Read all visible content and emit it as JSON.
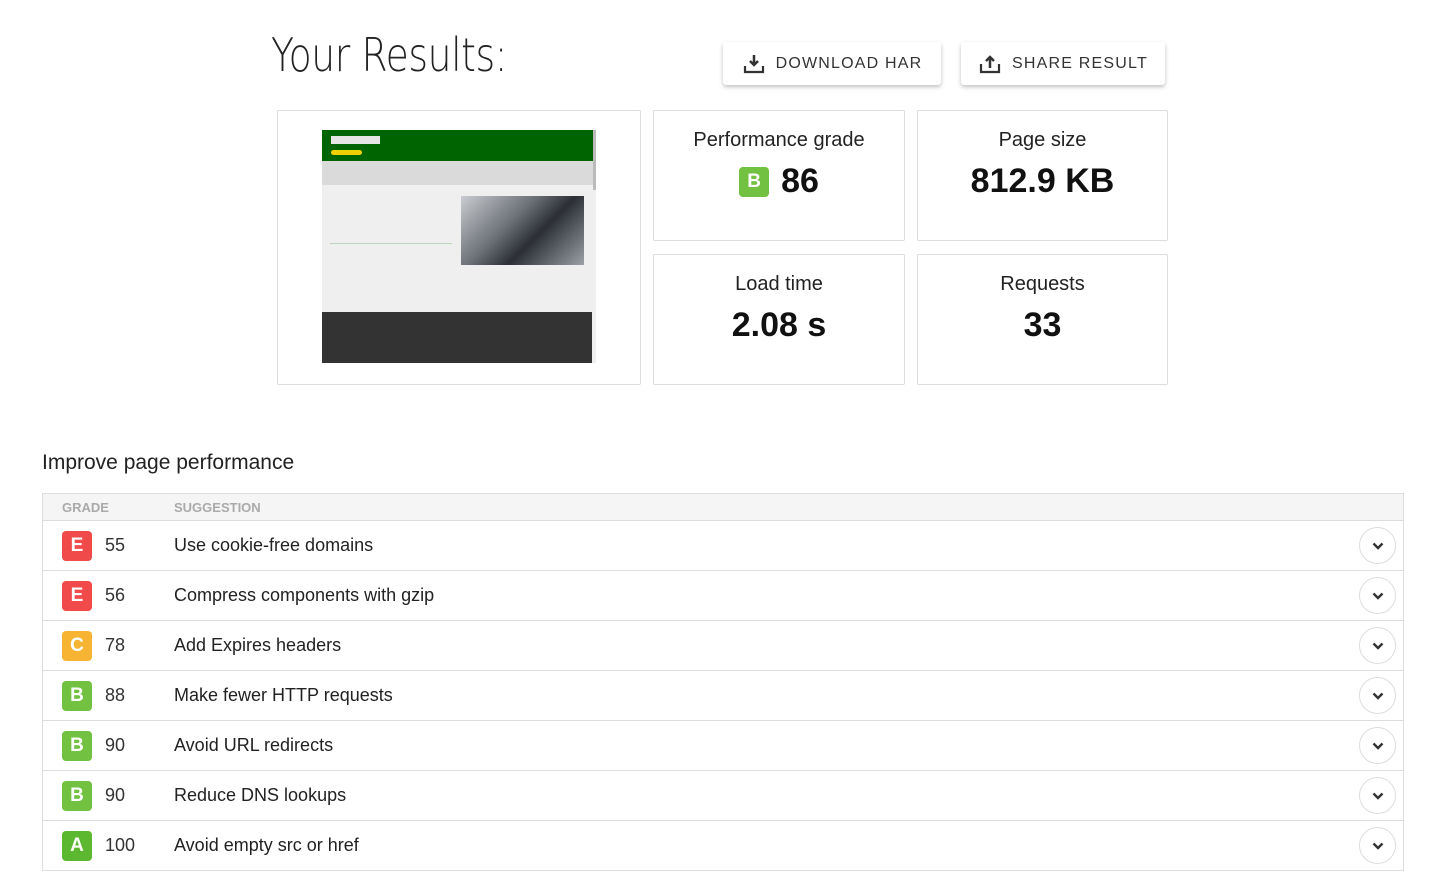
{
  "header": {
    "title": "Your Results:",
    "download_label": "DOWNLOAD HAR",
    "share_label": "SHARE RESULT"
  },
  "metrics": {
    "performance": {
      "label": "Performance grade",
      "grade": "B",
      "value": "86",
      "color": "#72c140"
    },
    "page_size": {
      "label": "Page size",
      "value": "812.9 KB"
    },
    "load_time": {
      "label": "Load time",
      "value": "2.08 s"
    },
    "requests": {
      "label": "Requests",
      "value": "33"
    }
  },
  "improve": {
    "title": "Improve page performance",
    "col_grade": "GRADE",
    "col_suggestion": "SUGGESTION",
    "rows": [
      {
        "grade": "E",
        "score": "55",
        "suggestion": "Use cookie-free domains",
        "color": "#f04a4a"
      },
      {
        "grade": "E",
        "score": "56",
        "suggestion": "Compress components with gzip",
        "color": "#f04a4a"
      },
      {
        "grade": "C",
        "score": "78",
        "suggestion": "Add Expires headers",
        "color": "#f7b432"
      },
      {
        "grade": "B",
        "score": "88",
        "suggestion": "Make fewer HTTP requests",
        "color": "#72c140"
      },
      {
        "grade": "B",
        "score": "90",
        "suggestion": "Avoid URL redirects",
        "color": "#72c140"
      },
      {
        "grade": "B",
        "score": "90",
        "suggestion": "Reduce DNS lookups",
        "color": "#72c140"
      },
      {
        "grade": "A",
        "score": "100",
        "suggestion": "Avoid empty src or href",
        "color": "#5cb82f"
      }
    ]
  }
}
